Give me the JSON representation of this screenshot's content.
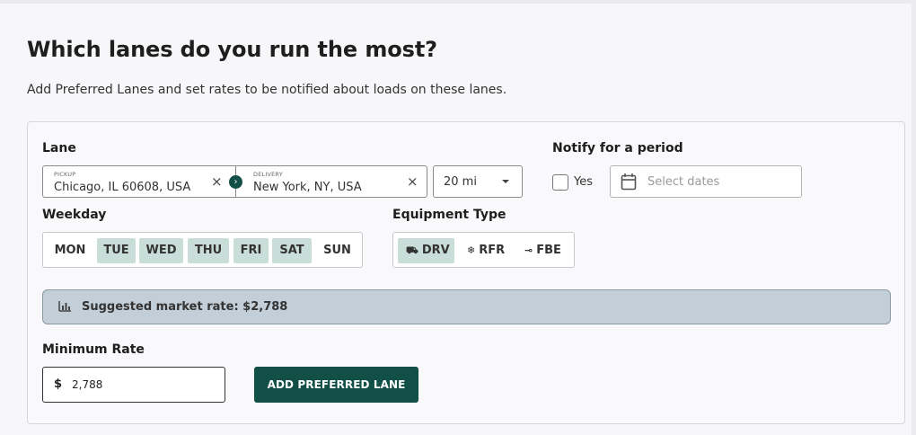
{
  "header": {
    "title": "Which lanes do you run the most?",
    "subtitle": "Add Preferred Lanes and set rates to be notified about loads on these lanes."
  },
  "lane": {
    "label": "Lane",
    "pickup_label": "PICKUP",
    "pickup_value": "Chicago, IL 60608, USA",
    "delivery_label": "DELIVERY",
    "delivery_value": "New York, NY, USA",
    "clear_glyph": "×",
    "radius": "20 mi"
  },
  "notify": {
    "label": "Notify for a period",
    "checkbox_label": "Yes",
    "checked": false,
    "dates_placeholder": "Select dates"
  },
  "weekday": {
    "label": "Weekday",
    "days": [
      {
        "label": "MON",
        "selected": false
      },
      {
        "label": "TUE",
        "selected": true
      },
      {
        "label": "WED",
        "selected": true
      },
      {
        "label": "THU",
        "selected": true
      },
      {
        "label": "FRI",
        "selected": true
      },
      {
        "label": "SAT",
        "selected": true
      },
      {
        "label": "SUN",
        "selected": false
      }
    ]
  },
  "equipment": {
    "label": "Equipment Type",
    "types": [
      {
        "label": "DRV",
        "icon": "truck-icon",
        "selected": true
      },
      {
        "label": "RFR",
        "icon": "snowflake-icon",
        "selected": false
      },
      {
        "label": "FBE",
        "icon": "flatbed-icon",
        "selected": false
      }
    ]
  },
  "suggestion": {
    "icon": "bar-chart-icon",
    "text": "Suggested market rate: $2,788"
  },
  "min_rate": {
    "label": "Minimum Rate",
    "currency": "$",
    "value": "2,788"
  },
  "actions": {
    "add_label": "ADD PREFERRED LANE"
  },
  "colors": {
    "primary": "#124f47",
    "selected_chip": "#c9ddd9",
    "suggestion_bg": "#c3cfd8"
  }
}
